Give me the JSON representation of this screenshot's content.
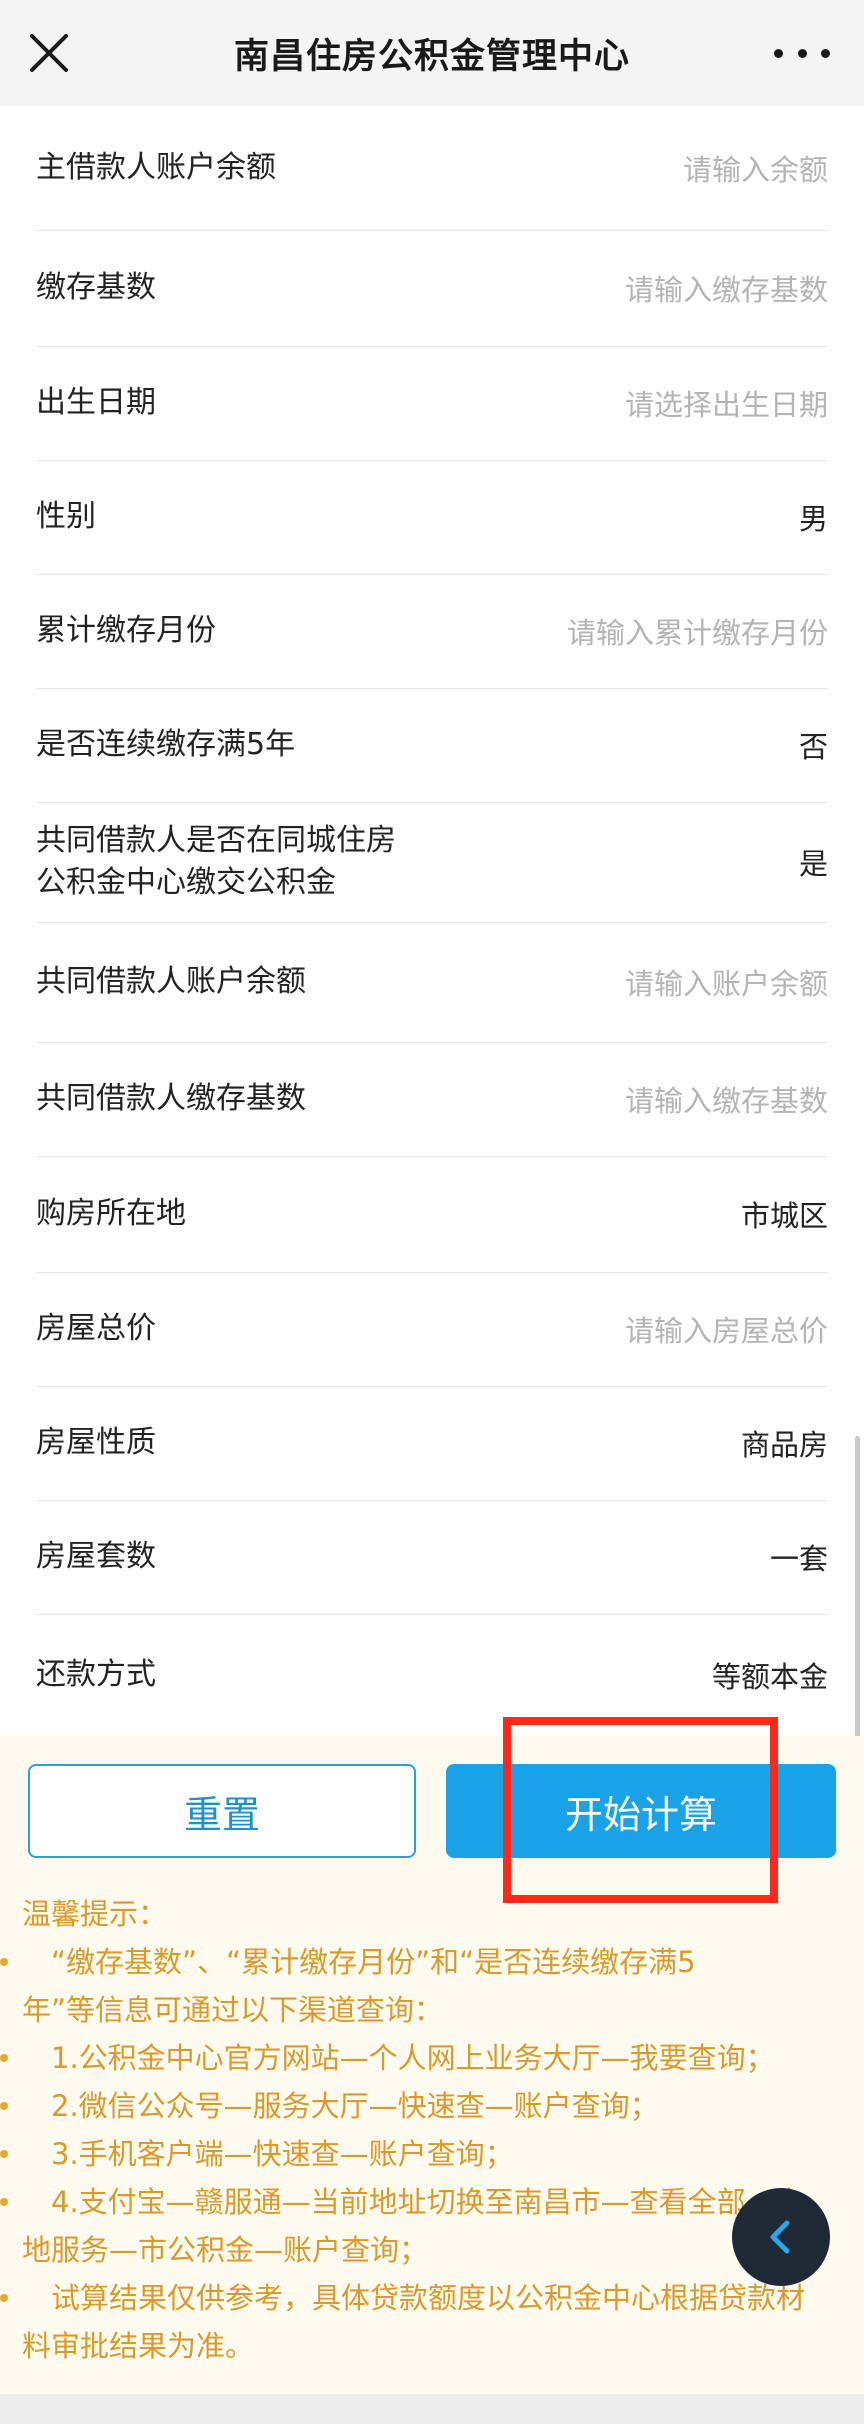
{
  "header": {
    "title": "南昌住房公积金管理中心",
    "close_icon": "close-icon",
    "more_icon": "more-icon"
  },
  "form": {
    "rows": [
      {
        "label": "主借款人账户余额",
        "value": "请输入余额",
        "placeholder": true
      },
      {
        "label": "缴存基数",
        "value": "请输入缴存基数",
        "placeholder": true
      },
      {
        "label": "出生日期",
        "value": "请选择出生日期",
        "placeholder": true
      },
      {
        "label": "性别",
        "value": "男",
        "placeholder": false
      },
      {
        "label": "累计缴存月份",
        "value": "请输入累计缴存月份",
        "placeholder": true
      },
      {
        "label": "是否连续缴存满5年",
        "value": "否",
        "placeholder": false
      },
      {
        "label_line1": "共同借款人是否在同城住房",
        "label_line2": "公积金中心缴交公积金",
        "value": "是",
        "placeholder": false
      },
      {
        "label": "共同借款人账户余额",
        "value": "请输入账户余额",
        "placeholder": true
      },
      {
        "label": "共同借款人缴存基数",
        "value": "请输入缴存基数",
        "placeholder": true
      },
      {
        "label": "购房所在地",
        "value": "市城区",
        "placeholder": false
      },
      {
        "label": "房屋总价",
        "value": "请输入房屋总价",
        "placeholder": true
      },
      {
        "label": "房屋性质",
        "value": "商品房",
        "placeholder": false
      },
      {
        "label": "房屋套数",
        "value": "一套",
        "placeholder": false
      },
      {
        "label": "还款方式",
        "value": "等额本金",
        "placeholder": false
      }
    ]
  },
  "buttons": {
    "reset_label": "重置",
    "calculate_label": "开始计算"
  },
  "tips": {
    "title": "温馨提示：",
    "items": [
      {
        "line1": "　“缴存基数”、“累计缴存月份”和“是否连续缴存满5",
        "line2": "年”等信息可通过以下渠道查询："
      },
      {
        "line1": "　1.公积金中心官方网站—个人网上业务大厅—我要查询；"
      },
      {
        "line1": "　2.微信公众号—服务大厅—快速查—账户查询；"
      },
      {
        "line1": "　3.手机客户端—快速查—账户查询；"
      },
      {
        "line1": "　4.支付宝—赣服通—当前地址切换至南昌市—查看全部—本",
        "line2": "地服务—市公积金—账户查询；"
      },
      {
        "line1": "　试算结果仅供参考，具体贷款额度以公积金中心根据贷款材",
        "line2": "料审批结果为准。"
      }
    ]
  },
  "floating": {
    "icon": "chevron-left-icon"
  },
  "colors": {
    "accent": "#1aa2e6",
    "tip_text": "#d99a29",
    "highlight": "#ff2a1a",
    "placeholder": "#b4b4b4"
  }
}
